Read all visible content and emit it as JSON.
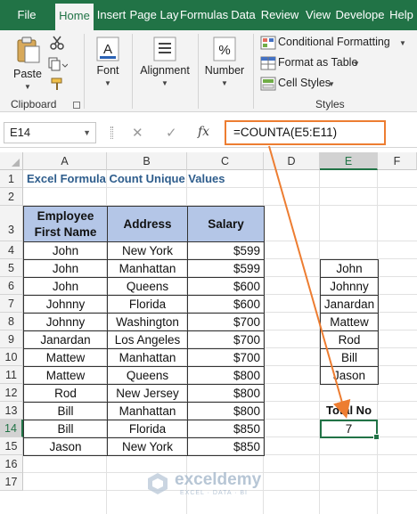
{
  "ribbon": {
    "tabs": [
      {
        "label": "File",
        "active": false
      },
      {
        "label": "Home",
        "active": true
      },
      {
        "label": "Insert",
        "active": false
      },
      {
        "label": "Page Lay",
        "active": false
      },
      {
        "label": "Formulas",
        "active": false
      },
      {
        "label": "Data",
        "active": false
      },
      {
        "label": "Review",
        "active": false
      },
      {
        "label": "View",
        "active": false
      },
      {
        "label": "Develope",
        "active": false
      },
      {
        "label": "Help",
        "active": false
      }
    ],
    "clipboard": {
      "paste_label": "Paste",
      "group_label": "Clipboard"
    },
    "font_label": "Font",
    "alignment_label": "Alignment",
    "number_label": "Number",
    "number_symbol": "%",
    "styles": {
      "conditional_formatting": "Conditional Formatting",
      "format_as_table": "Format as Table",
      "cell_styles": "Cell Styles",
      "group_label": "Styles"
    }
  },
  "formula_bar": {
    "name_box": "E14",
    "cancel_symbol": "✕",
    "enter_symbol": "✓",
    "fx_symbol": "fx",
    "formula": "=COUNTA(E5:E11)"
  },
  "sheet": {
    "columns": [
      "A",
      "B",
      "C",
      "D",
      "E",
      "F"
    ],
    "rows": [
      "1",
      "2",
      "3",
      "4",
      "5",
      "6",
      "7",
      "8",
      "9",
      "10",
      "11",
      "12",
      "13",
      "14",
      "15",
      "16",
      "17"
    ],
    "selected_column": "E",
    "selected_row": "14",
    "title": "Excel Formula Count Unique Values",
    "headers": {
      "name": "Employee First Name",
      "address": "Address",
      "salary": "Salary"
    },
    "records": [
      {
        "name": "John",
        "address": "New York",
        "salary": "$599"
      },
      {
        "name": "John",
        "address": "Manhattan",
        "salary": "$599"
      },
      {
        "name": "John",
        "address": "Queens",
        "salary": "$600"
      },
      {
        "name": "Johnny",
        "address": "Florida",
        "salary": "$600"
      },
      {
        "name": "Johnny",
        "address": "Washington",
        "salary": "$700"
      },
      {
        "name": "Janardan",
        "address": "Los Angeles",
        "salary": "$700"
      },
      {
        "name": "Mattew",
        "address": "Manhattan",
        "salary": "$700"
      },
      {
        "name": "Mattew",
        "address": "Queens",
        "salary": "$800"
      },
      {
        "name": "Rod",
        "address": "New Jersey",
        "salary": "$800"
      },
      {
        "name": "Bill",
        "address": "Manhattan",
        "salary": "$800"
      },
      {
        "name": "Bill",
        "address": "Florida",
        "salary": "$850"
      },
      {
        "name": "Jason",
        "address": "New York",
        "salary": "$850"
      }
    ],
    "unique_names": [
      "John",
      "Johnny",
      "Janardan",
      "Mattew",
      "Rod",
      "Bill",
      "Jason"
    ],
    "total_label": "Total No",
    "total_value": "7"
  },
  "watermark": {
    "name": "exceldemy",
    "tagline": "EXCEL · DATA · BI"
  },
  "colors": {
    "excel_green": "#217346",
    "header_fill": "#b4c6e7",
    "title_blue": "#2e5d8c",
    "callout_orange": "#ed7d31"
  }
}
